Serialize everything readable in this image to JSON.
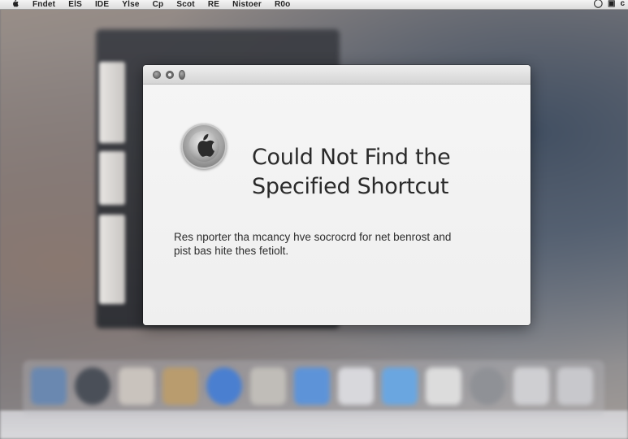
{
  "menubar": {
    "apple_glyph": "",
    "items": [
      "Fndet",
      "ElS",
      "IDE",
      "Ylse",
      "Cp",
      "Scot",
      "RE",
      "Nistoer",
      "R0o"
    ],
    "status_icons": [
      "screen-mirroring-icon",
      "display-icon",
      "clock-icon"
    ],
    "status_glyphs": [
      "◯",
      "▣",
      "c"
    ]
  },
  "dialog": {
    "title_line1": "Could Not Find the",
    "title_line2": "Specified Shortcut",
    "message_line1": "Res nporter tha mcancy hve socrocrd for net benrost and",
    "message_line2": "pist bas hite thes fetiolt.",
    "icon": "apple-logo-icon",
    "traffic_lights": [
      "close-button",
      "minimize-button",
      "zoom-button"
    ]
  },
  "dock": {
    "icons": [
      "finder-icon",
      "clock-icon",
      "app-icon",
      "photos-icon",
      "safari-icon",
      "preview-icon",
      "mail-icon",
      "document-icon",
      "appstore-icon",
      "notes-icon",
      "settings-icon",
      "calendar-icon",
      "trash-icon"
    ],
    "colors": [
      "#6a88b0",
      "#4a4f58",
      "#c9c3bd",
      "#b99c6e",
      "#4a7fd0",
      "#c0bdb8",
      "#5d93d8",
      "#d8d8dc",
      "#6aa6e0",
      "#dcdcdc",
      "#8f9196",
      "#cfcfd2",
      "#c8c8cc"
    ]
  },
  "colors": {
    "dialog_bg": "#f3f3f3",
    "titlebar_bg": "#d5d5d5",
    "title_text": "#2a2a2a",
    "desktop_bg": "#7e7c80"
  }
}
